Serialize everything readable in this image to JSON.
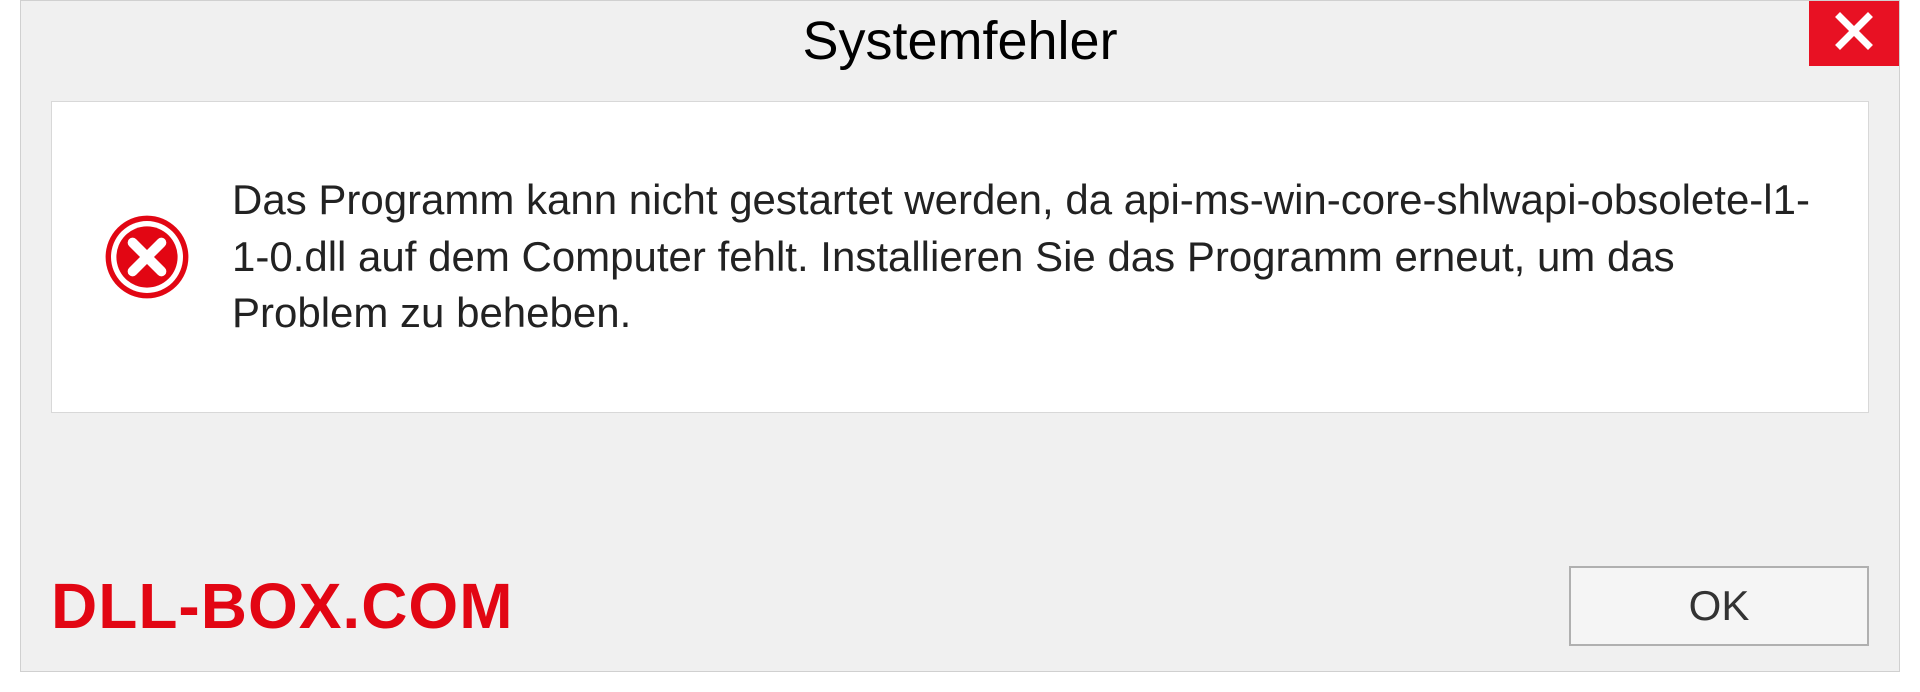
{
  "dialog": {
    "title": "Systemfehler",
    "message": "Das Programm kann nicht gestartet werden, da api-ms-win-core-shlwapi-obsolete-l1-1-0.dll auf dem Computer fehlt. Installieren Sie das Programm erneut, um das Problem zu beheben.",
    "ok_label": "OK"
  },
  "watermark": "DLL-BOX.COM",
  "colors": {
    "close_bg": "#e81123",
    "error_icon": "#e20613",
    "watermark": "#e20613"
  }
}
